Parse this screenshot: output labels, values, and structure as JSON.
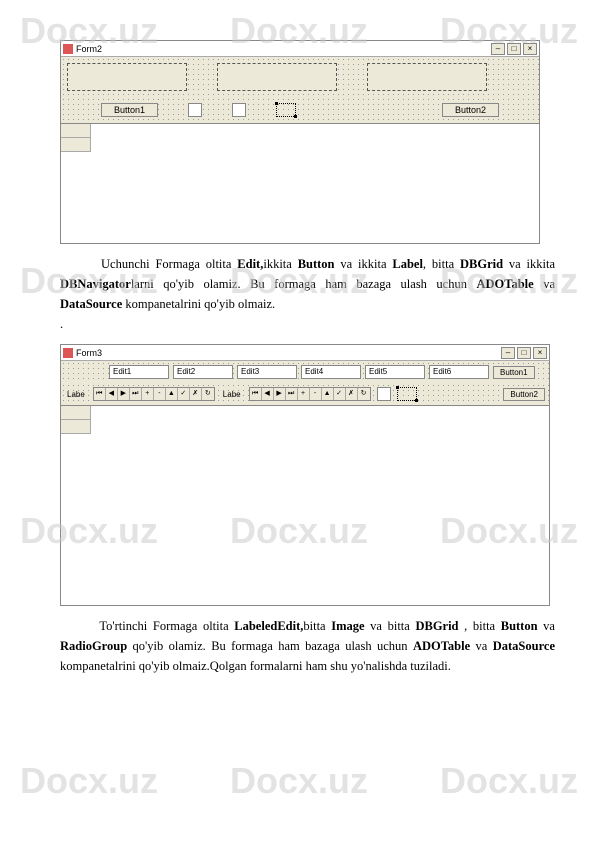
{
  "watermark": "Docx.uz",
  "form2": {
    "title": "Form2",
    "button1": "Button1",
    "button2": "Button2"
  },
  "para1": {
    "text_pre": "Uchunchi Formaga oltita ",
    "edit": "Edit,",
    "t1": "ikkita ",
    "button": "Button",
    "t2": " va ikkita ",
    "label": "Label",
    "t3": ", bitta ",
    "dbgrid": "DBGrid",
    "t4": " va ikkita ",
    "dbnav": "DBNavigator",
    "t5": "larni qo'yib olamiz. Bu formaga ham bazaga ulash uchun ",
    "adotable": "ADOTable",
    "t6": " va ",
    "datasource": "DataSource",
    "t7": " kompanetalrini qo'yib olmaiz.",
    "dot": "."
  },
  "form3": {
    "title": "Form3",
    "edits": [
      "Edit1",
      "Edit2",
      "Edit3",
      "Edit4",
      "Edit5",
      "Edit6"
    ],
    "label": "Labe",
    "button1": "Button1",
    "button2": "Button2"
  },
  "para2": {
    "text_pre": "To'rtinchi Formaga oltita ",
    "labelededit": "LabeledEdit,",
    "t1": "bitta ",
    "image": "Image",
    "t2": " va bitta ",
    "dbgrid": "DBGrid",
    "t3": " , bitta ",
    "button": "Button",
    "t4": " va ",
    "radiogroup": "RadioGroup",
    "t5": " qo'yib olamiz. Bu formaga ham bazaga ulash uchun ",
    "adotable": "ADOTable",
    "t6": " va ",
    "datasource": "DataSource",
    "t7": " kompanetalrini qo'yib olmaiz.Qolgan formalarni ham shu yo'nalishda tuziladi."
  }
}
